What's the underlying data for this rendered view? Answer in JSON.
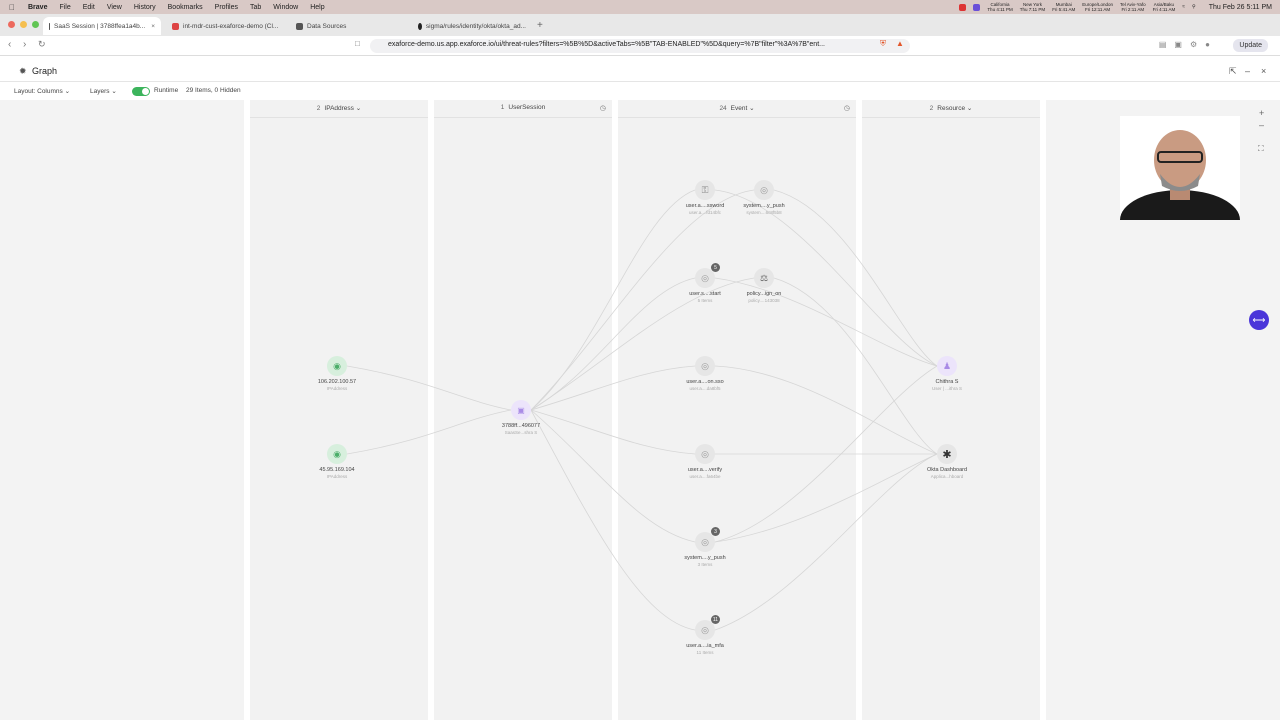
{
  "menubar": {
    "app": "Brave",
    "items": [
      "File",
      "Edit",
      "View",
      "History",
      "Bookmarks",
      "Profiles",
      "Tab",
      "Window",
      "Help"
    ],
    "timezones": [
      {
        "name": "California",
        "time": "Thu 4:11 PM"
      },
      {
        "name": "New York",
        "time": "Thu 7:11 PM"
      },
      {
        "name": "Mumbai",
        "time": "Fri 5:41 AM"
      },
      {
        "name": "Europe/London",
        "time": "Fri 12:11 AM"
      },
      {
        "name": "Tel Aviv-Yafo",
        "time": "Fri 2:11 AM"
      },
      {
        "name": "Asia/Baku",
        "time": "Fri 4:11 AM"
      }
    ],
    "clock": "Thu Feb 26  5:11 PM"
  },
  "tabs": [
    {
      "label": "SaaS Session | 3788ffea1a4b...",
      "active": true
    },
    {
      "label": "int-mdr-cust-exaforce-demo (Cl...",
      "active": false
    },
    {
      "label": "Data Sources",
      "active": false
    },
    {
      "label": "sigma/rules/identity/okta/okta_ad...",
      "active": false
    }
  ],
  "address": {
    "url": "exaforce-demo.us.app.exaforce.io/ui/threat-rules?filters=%5B%5D&activeTabs=%5B\"TAB-ENABLED\"%5D&query=%7B\"filter\"%3A%7B\"ent...",
    "update_label": "Update"
  },
  "panel": {
    "title": "Graph",
    "layout_label": "Layout: Columns",
    "layers_label": "Layers",
    "runtime_label": "Runtime",
    "items_summary": "29 Items, 0 Hidden"
  },
  "columns": [
    {
      "count": "2",
      "name": "IPAddress"
    },
    {
      "count": "1",
      "name": "UserSession"
    },
    {
      "count": "24",
      "name": "Event"
    },
    {
      "count": "2",
      "name": "Resource"
    }
  ],
  "nodes": {
    "ip1": {
      "label": "106.202.100.57",
      "sub": "IPAddress",
      "icon": "globe-icon"
    },
    "ip2": {
      "label": "45.95.169.104",
      "sub": "IPAddress",
      "icon": "globe-icon"
    },
    "session": {
      "label": "3788ff...496077",
      "sub": "SaasSe...shra S",
      "icon": "session-icon"
    },
    "e1": {
      "label": "user.a....ssword",
      "sub": "user.a....fd14bfc",
      "icon": "lock-icon"
    },
    "e2": {
      "label": "system....y_push",
      "sub": "system....6c8f5b8",
      "icon": "fingerprint-icon"
    },
    "e3": {
      "label": "user.s....start",
      "sub": "5 Items",
      "badge": "5",
      "icon": "fingerprint-icon"
    },
    "e4": {
      "label": "policy...ign_on",
      "sub": "policy....143038",
      "icon": "gavel-icon"
    },
    "e5": {
      "label": "user.a....on.sso",
      "sub": "user.a....da8bf5",
      "icon": "fingerprint-icon"
    },
    "e6": {
      "label": "user.a....verify",
      "sub": "user.a....fa64be",
      "icon": "fingerprint-icon"
    },
    "e7": {
      "label": "system....y_push",
      "sub": "3 Items",
      "badge": "3",
      "icon": "fingerprint-icon"
    },
    "e8": {
      "label": "user.a....ia_mfa",
      "sub": "11 Items",
      "badge": "11",
      "icon": "fingerprint-icon"
    },
    "r1": {
      "label": "Chithra S",
      "sub": "User | ...ithra S",
      "icon": "user-icon"
    },
    "r2": {
      "label": "Okta Dashboard",
      "sub": "Applica...hboard",
      "icon": "asterisk-icon"
    }
  },
  "colors": {
    "ip": "#4cae6a",
    "session": "#a98be6",
    "event": "#9c9c9c",
    "resource_user": "#a98be6",
    "resource_app": "#444444",
    "toggle_on": "#3cb45c",
    "fab": "#4a35d9"
  }
}
